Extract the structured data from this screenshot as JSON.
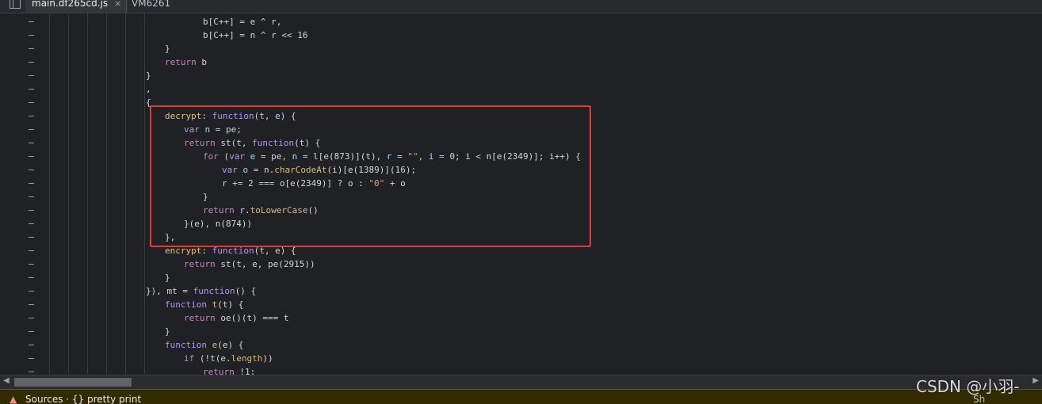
{
  "tabs": [
    {
      "label": "main.df265cd.js",
      "active": true,
      "close": "×"
    },
    {
      "label": "VM6261",
      "active": false
    }
  ],
  "icons": {
    "navigator_toggle": "sidebar-toggle-icon",
    "warning": "warning-icon"
  },
  "code_lines": [
    [
      [
        "b[C++] = e ^ r,",
        "op"
      ]
    ],
    [
      [
        "b[C++] = n ^ r << 16",
        "op"
      ]
    ],
    [
      [
        "}",
        "op"
      ]
    ],
    [
      [
        "return",
        "kw"
      ],
      [
        " b",
        "op"
      ]
    ],
    [
      [
        "}",
        "op"
      ]
    ],
    [
      [
        ",",
        "op"
      ]
    ],
    [
      [
        "{",
        "op"
      ]
    ],
    [
      [
        "decrypt",
        "prop"
      ],
      [
        ": ",
        "op"
      ],
      [
        "function",
        "kw2"
      ],
      [
        "(t, ",
        "op"
      ],
      [
        "e",
        "var"
      ],
      [
        ") {",
        "op"
      ]
    ],
    [
      [
        "var",
        "kw2"
      ],
      [
        " ",
        "op"
      ],
      [
        "n",
        "var"
      ],
      [
        " = pe;",
        "op"
      ]
    ],
    [
      [
        "return",
        "kw"
      ],
      [
        " st(t, ",
        "op"
      ],
      [
        "function",
        "kw2"
      ],
      [
        "(t) {",
        "op"
      ]
    ],
    [
      [
        "for",
        "kw"
      ],
      [
        " (",
        "op"
      ],
      [
        "var",
        "kw2"
      ],
      [
        " ",
        "op"
      ],
      [
        "e",
        "var"
      ],
      [
        " = pe, ",
        "op"
      ],
      [
        "n",
        "var"
      ],
      [
        " = l[e(873)](t), ",
        "op"
      ],
      [
        "r",
        "var"
      ],
      [
        " = ",
        "op"
      ],
      [
        "\"\"",
        "str"
      ],
      [
        ", ",
        "op"
      ],
      [
        "i",
        "var"
      ],
      [
        " = 0; i < n[e(2349)]; i++) {",
        "op"
      ]
    ],
    [
      [
        "var",
        "kw2"
      ],
      [
        " ",
        "op"
      ],
      [
        "o",
        "var"
      ],
      [
        " = n.",
        "op"
      ],
      [
        "charCodeAt",
        "fn"
      ],
      [
        "(i)[e(1389)](16);",
        "op"
      ]
    ],
    [
      [
        "r += 2 === o[e(2349)] ? o : ",
        "op"
      ],
      [
        "\"0\"",
        "str"
      ],
      [
        " + o",
        "op"
      ]
    ],
    [
      [
        "}",
        "op"
      ]
    ],
    [
      [
        "return",
        "kw"
      ],
      [
        " r.",
        "op"
      ],
      [
        "toLowerCase",
        "fn"
      ],
      [
        "()",
        "op"
      ]
    ],
    [
      [
        "}(e), n(874))",
        "op"
      ]
    ],
    [
      [
        "},",
        "op"
      ]
    ],
    [
      [
        "encrypt",
        "prop"
      ],
      [
        ": ",
        "op"
      ],
      [
        "function",
        "kw2"
      ],
      [
        "(t, e) {",
        "op"
      ]
    ],
    [
      [
        "return",
        "kw"
      ],
      [
        " st(t, e, pe(2915))",
        "op"
      ]
    ],
    [
      [
        "}",
        "op"
      ]
    ],
    [
      [
        "}), mt = ",
        "op"
      ],
      [
        "function",
        "kw2"
      ],
      [
        "() {",
        "op"
      ]
    ],
    [
      [
        "function",
        "kw2"
      ],
      [
        " ",
        "op"
      ],
      [
        "t",
        "fn"
      ],
      [
        "(t) {",
        "op"
      ]
    ],
    [
      [
        "return",
        "kw"
      ],
      [
        " oe()(t) === t",
        "op"
      ]
    ],
    [
      [
        "}",
        "op"
      ]
    ],
    [
      [
        "function",
        "kw2"
      ],
      [
        " ",
        "op"
      ],
      [
        "e",
        "fn"
      ],
      [
        "(e) {",
        "op"
      ]
    ],
    [
      [
        "if",
        "kw"
      ],
      [
        " (!t(e.",
        "op"
      ],
      [
        "length",
        "fn"
      ],
      [
        "))",
        "op"
      ]
    ],
    [
      [
        "return",
        "kw"
      ],
      [
        " !1;",
        "op"
      ]
    ]
  ],
  "console": {
    "message": "Sources  ·  {} pretty print",
    "right": "Sh"
  },
  "watermark": "CSDN @小羽-"
}
